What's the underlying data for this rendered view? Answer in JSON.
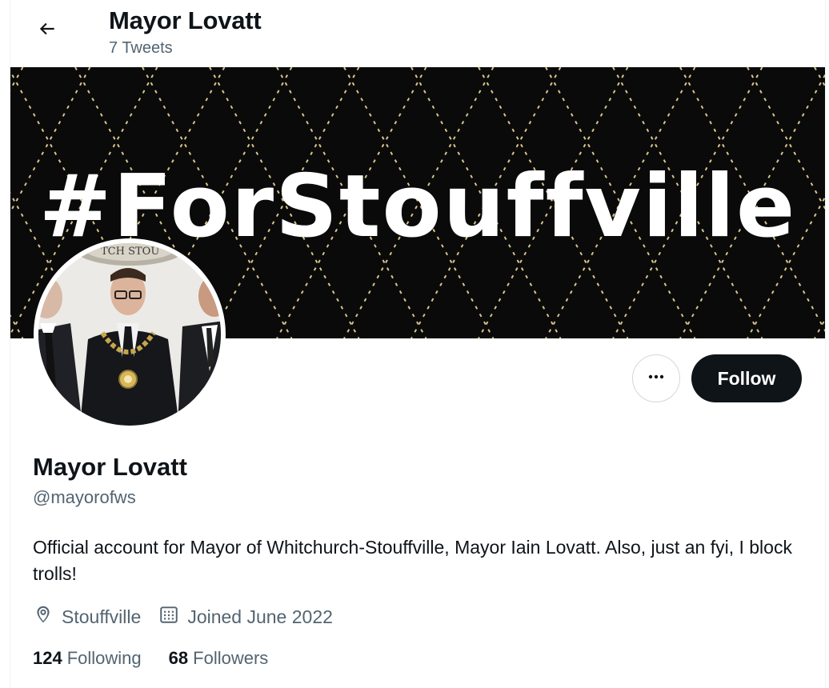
{
  "header": {
    "title": "Mayor Lovatt",
    "subtitle": "7 Tweets",
    "back_icon": "arrow-left-icon"
  },
  "banner": {
    "text": "#ForStouffville",
    "background_color": "#0a0a0a",
    "pattern_color": "#d9c48a"
  },
  "avatar": {
    "seal_text": "TCH STOU"
  },
  "actions": {
    "more_icon": "more-horizontal-icon",
    "follow_label": "Follow"
  },
  "profile": {
    "name": "Mayor Lovatt",
    "handle": "@mayorofws",
    "bio": "Official account for Mayor of Whitchurch-Stouffville, Mayor Iain Lovatt. Also, just an fyi, I block trolls!",
    "location": "Stouffville",
    "location_icon": "location-pin-icon",
    "joined": "Joined June 2022",
    "joined_icon": "calendar-icon"
  },
  "stats": {
    "following_count": "124",
    "following_label": "Following",
    "followers_count": "68",
    "followers_label": "Followers"
  },
  "colors": {
    "text_primary": "#0f1419",
    "text_secondary": "#536471",
    "button_dark": "#0f1419",
    "border": "#cfd9de"
  }
}
